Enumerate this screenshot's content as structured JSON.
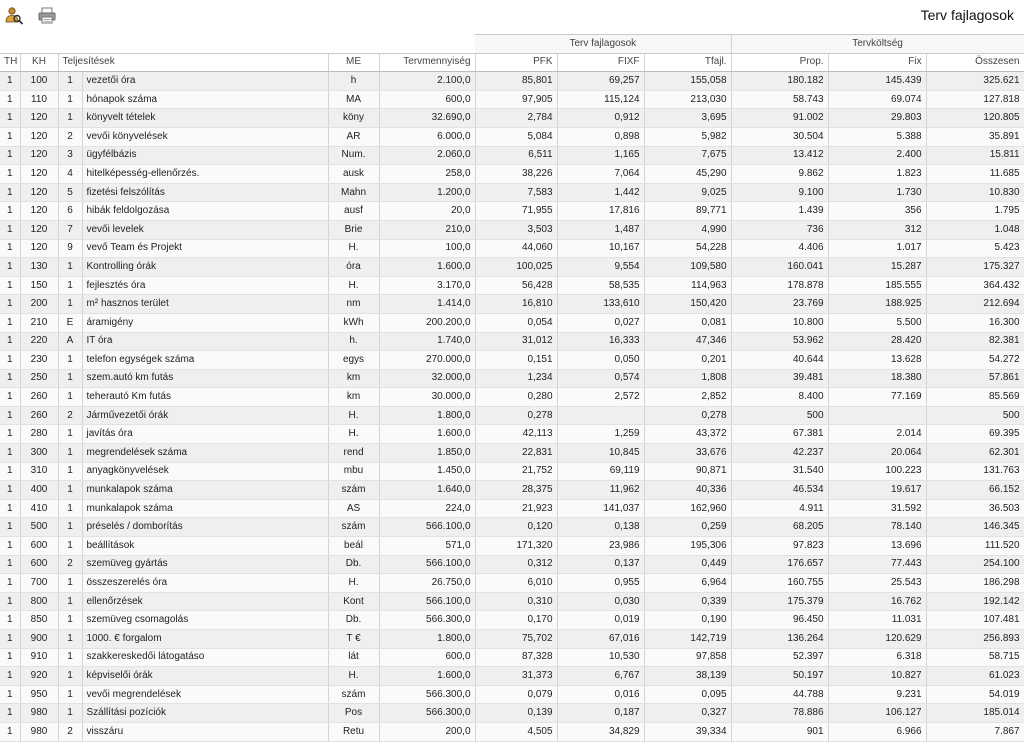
{
  "page": {
    "title": "Terv fajlagosok"
  },
  "toolbar": {
    "icons": [
      "user-search-icon",
      "print-icon"
    ]
  },
  "table": {
    "group_headers": {
      "cost_group": "Terv fajlagosok",
      "plan_group": "Tervköltség"
    },
    "columns": [
      "TH",
      "KH",
      "Teljesítések",
      "",
      "ME",
      "Tervmennyiség",
      "PFK",
      "FIXF",
      "Tfajl.",
      "Prop.",
      "Fix",
      "Összesen"
    ],
    "rows": [
      [
        "1",
        "100",
        "1",
        "vezetői óra",
        "h",
        "2.100,0",
        "85,801",
        "69,257",
        "155,058",
        "180.182",
        "145.439",
        "325.621"
      ],
      [
        "1",
        "110",
        "1",
        "hónapok száma",
        "MA",
        "600,0",
        "97,905",
        "115,124",
        "213,030",
        "58.743",
        "69.074",
        "127.818"
      ],
      [
        "1",
        "120",
        "1",
        "könyvelt tételek",
        "köny",
        "32.690,0",
        "2,784",
        "0,912",
        "3,695",
        "91.002",
        "29.803",
        "120.805"
      ],
      [
        "1",
        "120",
        "2",
        "vevői könyvelések",
        "AR",
        "6.000,0",
        "5,084",
        "0,898",
        "5,982",
        "30.504",
        "5.388",
        "35.891"
      ],
      [
        "1",
        "120",
        "3",
        "ügyfélbázis",
        "Num.",
        "2.060,0",
        "6,511",
        "1,165",
        "7,675",
        "13.412",
        "2.400",
        "15.811"
      ],
      [
        "1",
        "120",
        "4",
        "hitelképesség-ellenőrzés.",
        "ausk",
        "258,0",
        "38,226",
        "7,064",
        "45,290",
        "9.862",
        "1.823",
        "11.685"
      ],
      [
        "1",
        "120",
        "5",
        "fizetési felszólítás",
        "Mahn",
        "1.200,0",
        "7,583",
        "1,442",
        "9,025",
        "9.100",
        "1.730",
        "10.830"
      ],
      [
        "1",
        "120",
        "6",
        "hibák feldolgozása",
        "ausf",
        "20,0",
        "71,955",
        "17,816",
        "89,771",
        "1.439",
        "356",
        "1.795"
      ],
      [
        "1",
        "120",
        "7",
        "vevői levelek",
        "Brie",
        "210,0",
        "3,503",
        "1,487",
        "4,990",
        "736",
        "312",
        "1.048"
      ],
      [
        "1",
        "120",
        "9",
        "vevő Team és Projekt",
        "H.",
        "100,0",
        "44,060",
        "10,167",
        "54,228",
        "4.406",
        "1.017",
        "5.423"
      ],
      [
        "1",
        "130",
        "1",
        "Kontrolling órák",
        "óra",
        "1.600,0",
        "100,025",
        "9,554",
        "109,580",
        "160.041",
        "15.287",
        "175.327"
      ],
      [
        "1",
        "150",
        "1",
        "fejlesztés óra",
        "H.",
        "3.170,0",
        "56,428",
        "58,535",
        "114,963",
        "178.878",
        "185.555",
        "364.432"
      ],
      [
        "1",
        "200",
        "1",
        "m² hasznos terület",
        "nm",
        "1.414,0",
        "16,810",
        "133,610",
        "150,420",
        "23.769",
        "188.925",
        "212.694"
      ],
      [
        "1",
        "210",
        "E",
        "áramigény",
        "kWh",
        "200.200,0",
        "0,054",
        "0,027",
        "0,081",
        "10.800",
        "5.500",
        "16.300"
      ],
      [
        "1",
        "220",
        "A",
        "IT óra",
        "h.",
        "1.740,0",
        "31,012",
        "16,333",
        "47,346",
        "53.962",
        "28.420",
        "82.381"
      ],
      [
        "1",
        "230",
        "1",
        "telefon egységek száma",
        "egys",
        "270.000,0",
        "0,151",
        "0,050",
        "0,201",
        "40.644",
        "13.628",
        "54.272"
      ],
      [
        "1",
        "250",
        "1",
        "szem.autó km futás",
        "km",
        "32.000,0",
        "1,234",
        "0,574",
        "1,808",
        "39.481",
        "18.380",
        "57.861"
      ],
      [
        "1",
        "260",
        "1",
        "teherautó Km futás",
        "km",
        "30.000,0",
        "0,280",
        "2,572",
        "2,852",
        "8.400",
        "77.169",
        "85.569"
      ],
      [
        "1",
        "260",
        "2",
        "Járművezetői órák",
        "H.",
        "1.800,0",
        "0,278",
        "",
        "0,278",
        "500",
        "",
        "500"
      ],
      [
        "1",
        "280",
        "1",
        "javítás óra",
        "H.",
        "1.600,0",
        "42,113",
        "1,259",
        "43,372",
        "67.381",
        "2.014",
        "69.395"
      ],
      [
        "1",
        "300",
        "1",
        "megrendelések száma",
        "rend",
        "1.850,0",
        "22,831",
        "10,845",
        "33,676",
        "42.237",
        "20.064",
        "62.301"
      ],
      [
        "1",
        "310",
        "1",
        "anyagkönyvelések",
        "mbu",
        "1.450,0",
        "21,752",
        "69,119",
        "90,871",
        "31.540",
        "100.223",
        "131.763"
      ],
      [
        "1",
        "400",
        "1",
        "munkalapok száma",
        "szám",
        "1.640,0",
        "28,375",
        "11,962",
        "40,336",
        "46.534",
        "19.617",
        "66.152"
      ],
      [
        "1",
        "410",
        "1",
        "munkalapok száma",
        "AS",
        "224,0",
        "21,923",
        "141,037",
        "162,960",
        "4.911",
        "31.592",
        "36.503"
      ],
      [
        "1",
        "500",
        "1",
        "préselés / domborítás",
        "szám",
        "566.100,0",
        "0,120",
        "0,138",
        "0,259",
        "68.205",
        "78.140",
        "146.345"
      ],
      [
        "1",
        "600",
        "1",
        "beállítások",
        "beál",
        "571,0",
        "171,320",
        "23,986",
        "195,306",
        "97.823",
        "13.696",
        "111.520"
      ],
      [
        "1",
        "600",
        "2",
        "szemüveg gyártás",
        "Db.",
        "566.100,0",
        "0,312",
        "0,137",
        "0,449",
        "176.657",
        "77.443",
        "254.100"
      ],
      [
        "1",
        "700",
        "1",
        "összeszerelés óra",
        "H.",
        "26.750,0",
        "6,010",
        "0,955",
        "6,964",
        "160.755",
        "25.543",
        "186.298"
      ],
      [
        "1",
        "800",
        "1",
        "ellenőrzések",
        "Kont",
        "566.100,0",
        "0,310",
        "0,030",
        "0,339",
        "175.379",
        "16.762",
        "192.142"
      ],
      [
        "1",
        "850",
        "1",
        "szemüveg csomagolás",
        "Db.",
        "566.300,0",
        "0,170",
        "0,019",
        "0,190",
        "96.450",
        "11.031",
        "107.481"
      ],
      [
        "1",
        "900",
        "1",
        "1000. € forgalom",
        "T €",
        "1.800,0",
        "75,702",
        "67,016",
        "142,719",
        "136.264",
        "120.629",
        "256.893"
      ],
      [
        "1",
        "910",
        "1",
        "szakkereskedői látogatáso",
        "lát",
        "600,0",
        "87,328",
        "10,530",
        "97,858",
        "52.397",
        "6.318",
        "58.715"
      ],
      [
        "1",
        "920",
        "1",
        "képviselői órák",
        "H.",
        "1.600,0",
        "31,373",
        "6,767",
        "38,139",
        "50.197",
        "10.827",
        "61.023"
      ],
      [
        "1",
        "950",
        "1",
        "vevői megrendelések",
        "szám",
        "566.300,0",
        "0,079",
        "0,016",
        "0,095",
        "44.788",
        "9.231",
        "54.019"
      ],
      [
        "1",
        "980",
        "1",
        "Szállítási pozíciók",
        "Pos",
        "566.300,0",
        "0,139",
        "0,187",
        "0,327",
        "78.886",
        "106.127",
        "185.014"
      ],
      [
        "1",
        "980",
        "2",
        "visszáru",
        "Retu",
        "200,0",
        "4,505",
        "34,829",
        "39,334",
        "901",
        "6.966",
        "7.867"
      ]
    ]
  }
}
